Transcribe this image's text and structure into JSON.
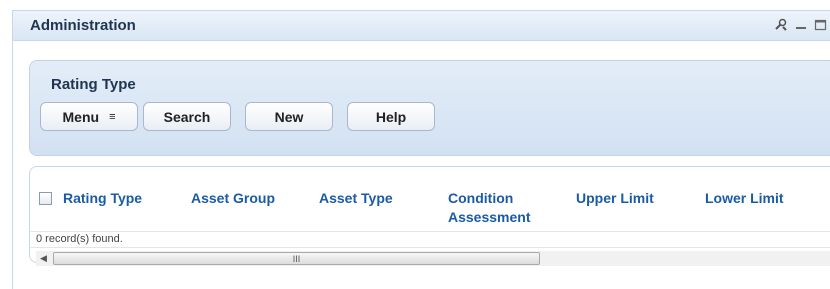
{
  "window": {
    "title": "Administration",
    "icons": [
      "tools-icon",
      "minimize-icon",
      "maximize-icon"
    ]
  },
  "criteria": {
    "title": "Rating Type",
    "buttons": {
      "menu": "Menu",
      "menu_icon": "≡",
      "search": "Search",
      "new": "New",
      "help": "Help"
    }
  },
  "grid": {
    "columns": [
      "Rating Type",
      "Asset Group",
      "Asset Type",
      "Condition Assessment",
      "Upper Limit",
      "Lower Limit"
    ],
    "columns_wrapped": {
      "condition_line1": "Condition",
      "condition_line2": "Assessment"
    },
    "status": "0 record(s) found.",
    "scroll_thumb_glyph": "III"
  },
  "colors": {
    "header_link": "#1a5ba6",
    "title_text": "#1f3550",
    "panel_bg": "#d9e6f4"
  }
}
